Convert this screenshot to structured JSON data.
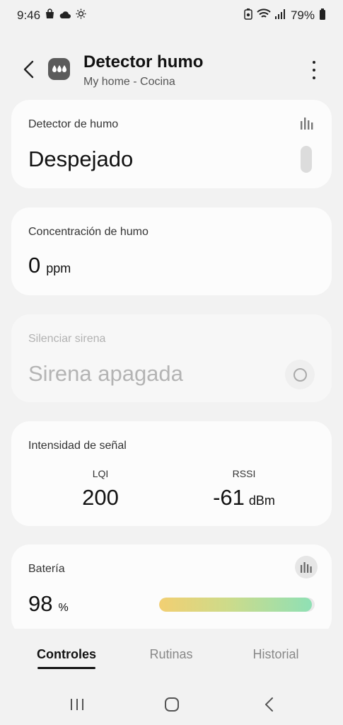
{
  "status_bar": {
    "time": "9:46",
    "battery": "79%"
  },
  "header": {
    "title": "Detector humo",
    "subtitle": "My home - Cocina"
  },
  "cards": {
    "detector": {
      "label": "Detector de humo",
      "value": "Despejado"
    },
    "concentration": {
      "label": "Concentración de humo",
      "value": "0",
      "unit": "ppm"
    },
    "siren": {
      "label": "Silenciar sirena",
      "value": "Sirena apagada"
    },
    "signal": {
      "label": "Intensidad de señal",
      "lqi_label": "LQI",
      "lqi_value": "200",
      "rssi_label": "RSSI",
      "rssi_value": "-61",
      "rssi_unit": "dBm"
    },
    "battery": {
      "label": "Batería",
      "value": "98",
      "unit": "%",
      "level": 0.98
    }
  },
  "tabs": [
    {
      "label": "Controles",
      "active": true
    },
    {
      "label": "Rutinas",
      "active": false
    },
    {
      "label": "Historial",
      "active": false
    }
  ],
  "colors": {
    "background": "#f2f2f2",
    "card": "#fcfcfc",
    "battery_gradient_start": "#f2cf72",
    "battery_gradient_end": "#8fe0b5"
  }
}
